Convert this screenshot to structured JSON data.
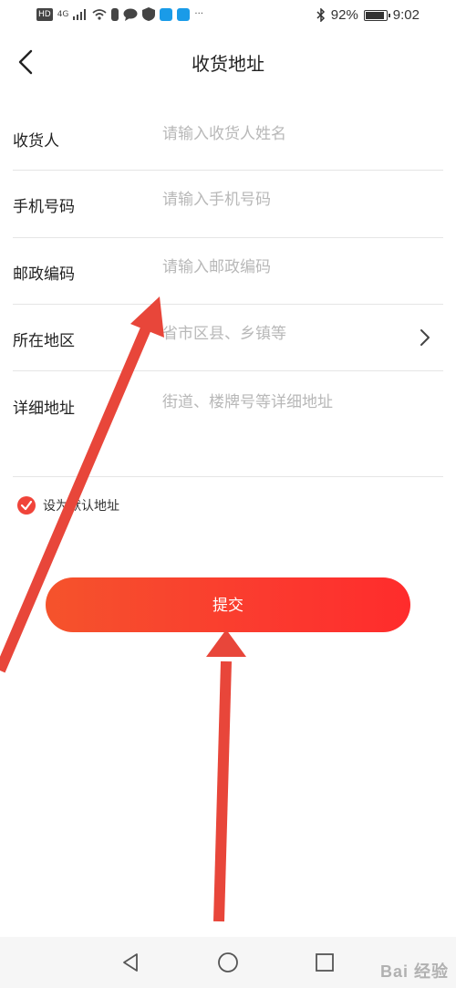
{
  "status_bar": {
    "time": "9:02",
    "battery_percent": "92%",
    "network": "4G",
    "hd_label": "HD",
    "more": "···",
    "battery_level": 0.92
  },
  "header": {
    "title": "收货地址",
    "back_icon": "chevron-left-icon"
  },
  "form": {
    "fields": [
      {
        "label": "收货人",
        "placeholder": "请输入收货人姓名",
        "value": ""
      },
      {
        "label": "手机号码",
        "placeholder": "请输入手机号码",
        "value": ""
      },
      {
        "label": "邮政编码",
        "placeholder": "请输入邮政编码",
        "value": ""
      },
      {
        "label": "所在地区",
        "placeholder": "省市区县、乡镇等",
        "value": ""
      },
      {
        "label": "详细地址",
        "placeholder": "街道、楼牌号等详细地址",
        "value": ""
      }
    ]
  },
  "default_address": {
    "label": "设为默认地址",
    "checked": true
  },
  "submit": {
    "label": "提交"
  },
  "watermark": "Bai 经验",
  "colors": {
    "accent": "#f5402c",
    "annotation_arrow": "#e8463a",
    "placeholder": "#b8b8b8",
    "divider": "#e5e5e5"
  }
}
